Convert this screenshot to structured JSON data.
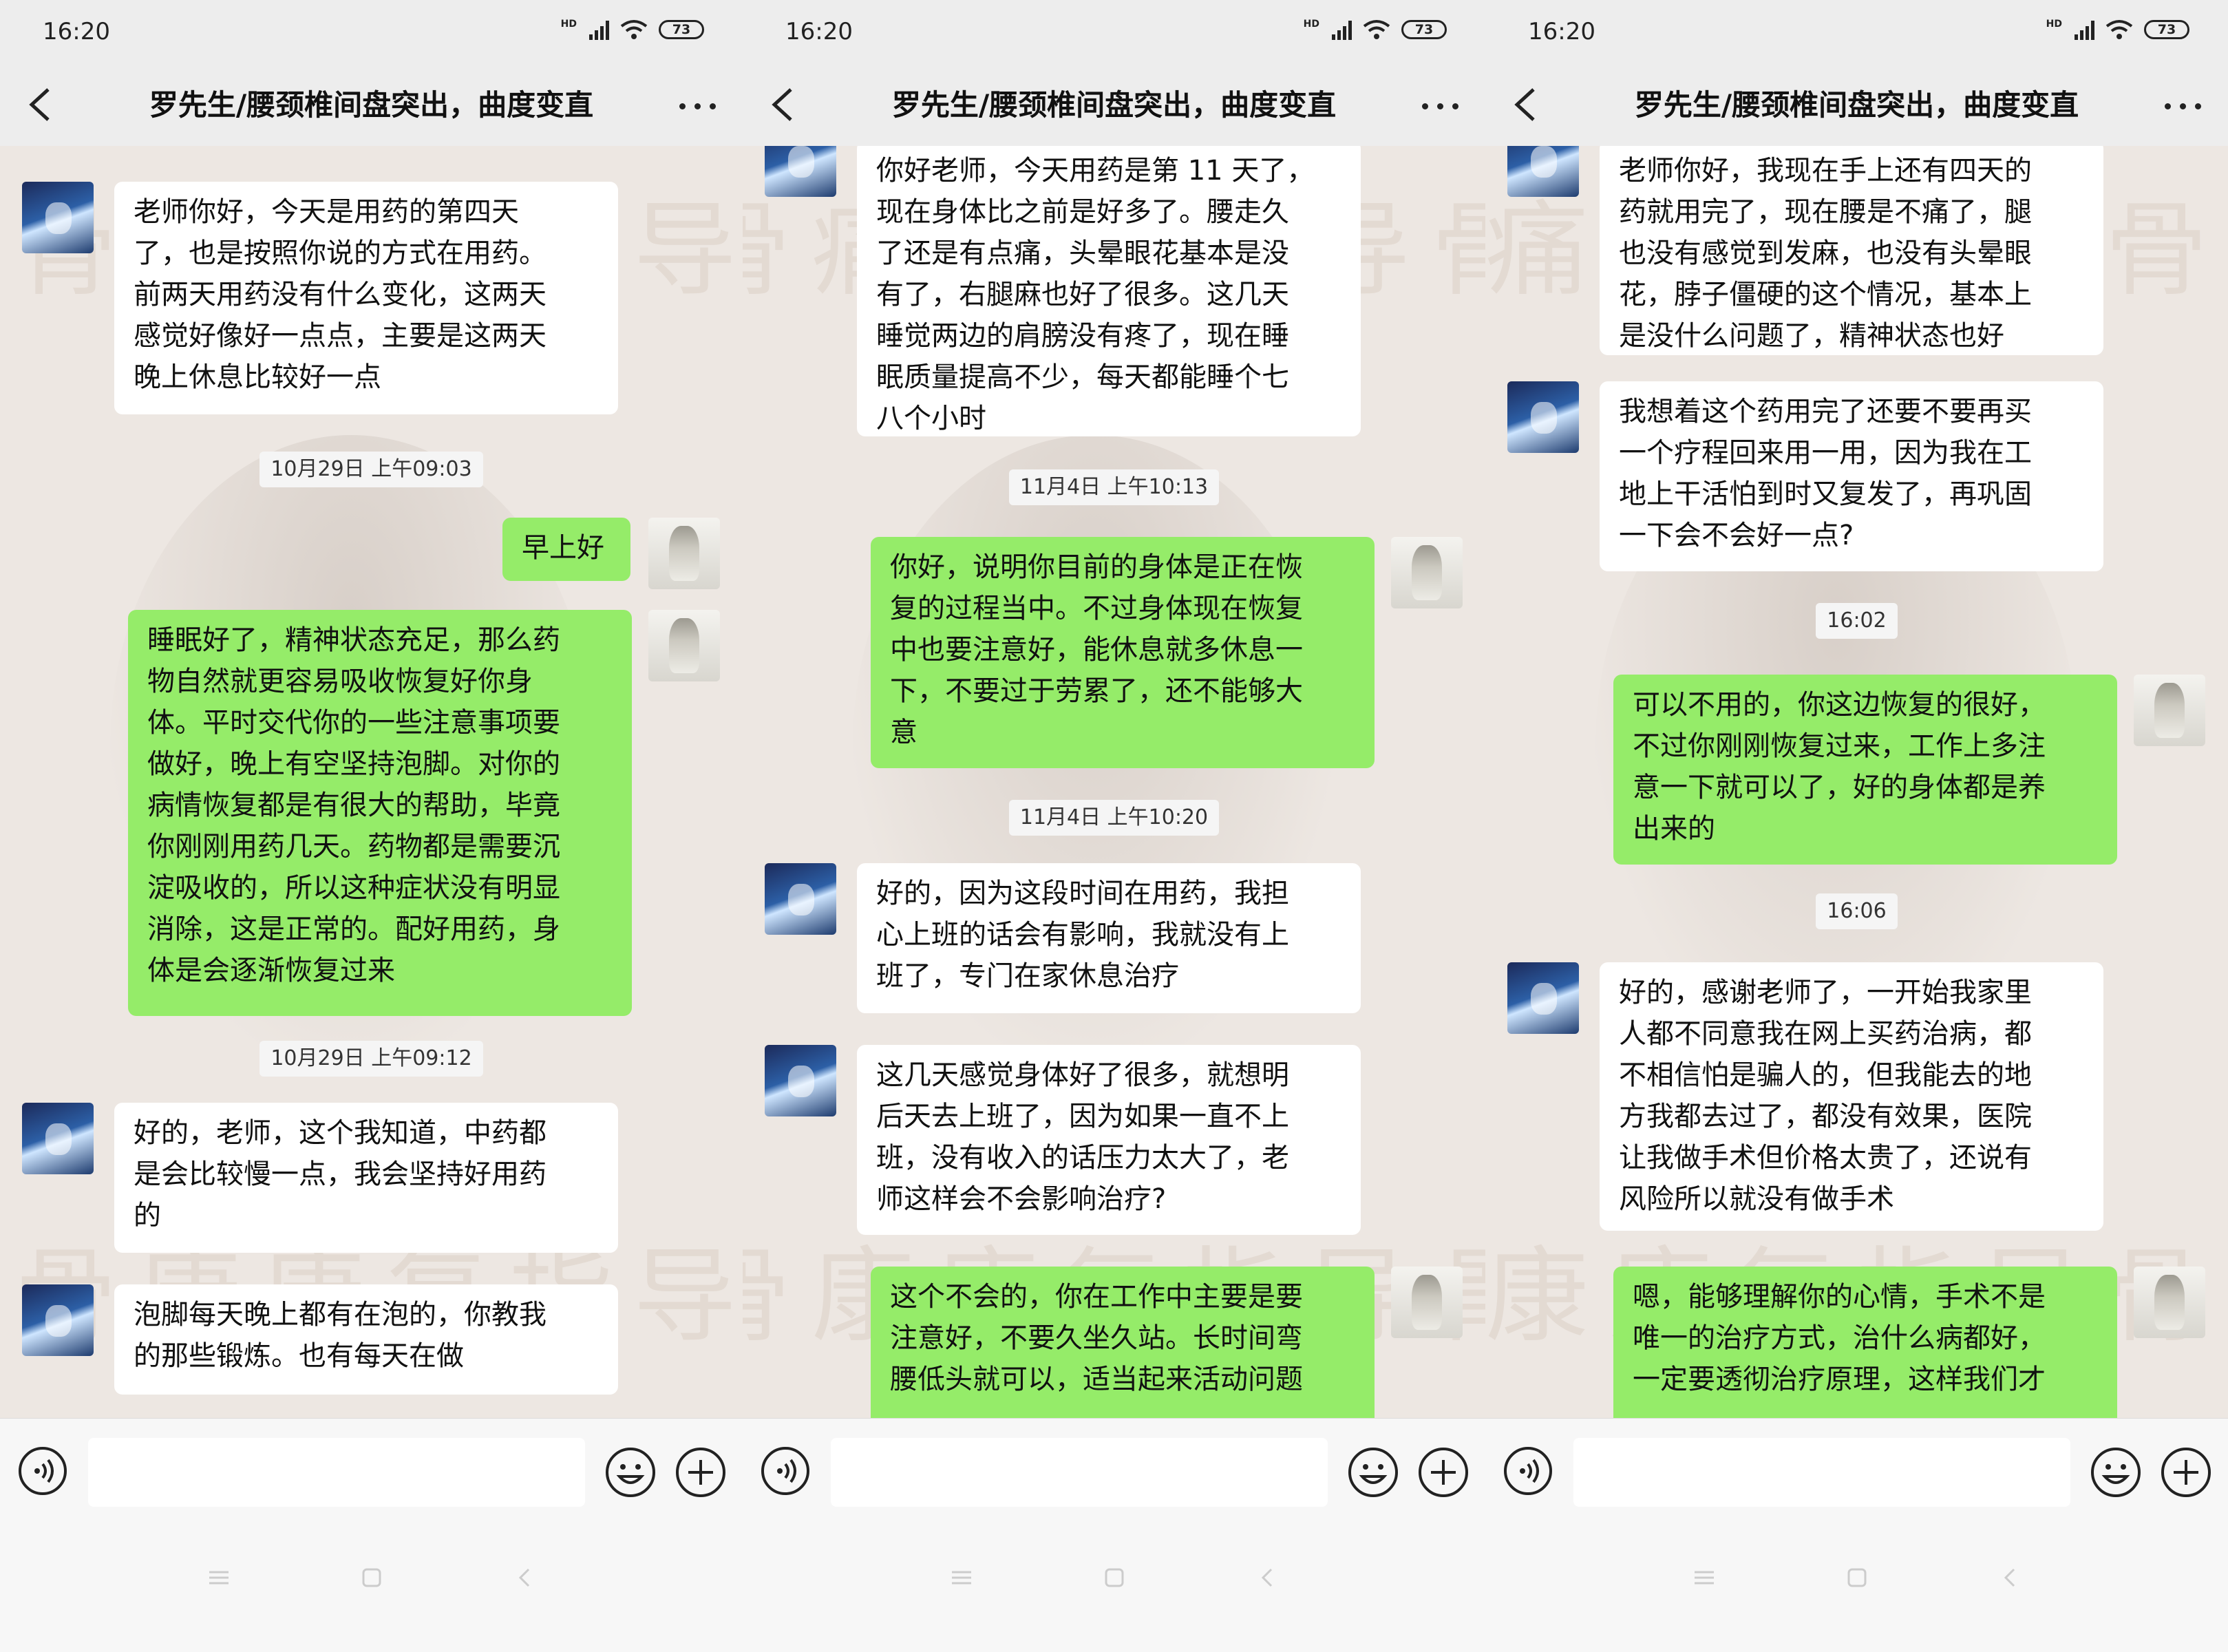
{
  "panels": [
    {
      "status": {
        "time": "16:20",
        "battery": "73"
      },
      "header": {
        "title": "罗先生/腰颈椎间盘突出，曲度变直"
      },
      "messages": [
        {
          "kind": "msg",
          "side": "left",
          "text": "老师你好，今天是用药的第四天\n了，也是按照你说的方式在用药。\n前两天用药没有什么变化，这两天\n感觉好像好一点点，主要是这两天\n晚上休息比较好一点"
        },
        {
          "kind": "time",
          "text": "10月29日 上午09:03"
        },
        {
          "kind": "msg",
          "side": "right",
          "text": "早上好"
        },
        {
          "kind": "msg",
          "side": "right",
          "text": "睡眠好了，精神状态充足，那么药\n物自然就更容易吸收恢复好你身\n体。平时交代你的一些注意事项要\n做好，晚上有空坚持泡脚。对你的\n病情恢复都是有很大的帮助，毕竟\n你刚刚用药几天。药物都是需要沉\n淀吸收的，所以这种症状没有明显\n消除，这是正常的。配好用药，身\n体是会逐渐恢复过来"
        },
        {
          "kind": "time",
          "text": "10月29日 上午09:12"
        },
        {
          "kind": "msg",
          "side": "left",
          "text": "好的，老师，这个我知道，中药都\n是会比较慢一点，我会坚持好用药\n的"
        },
        {
          "kind": "msg",
          "side": "left",
          "text": "泡脚每天晚上都有在泡的，你教我\n的那些锻炼。也有每天在做"
        }
      ]
    },
    {
      "status": {
        "time": "16:20",
        "battery": "73"
      },
      "header": {
        "title": "罗先生/腰颈椎间盘突出，曲度变直"
      },
      "messages": [
        {
          "kind": "msg",
          "side": "left",
          "text": "你好老师，今天用药是第 11 天了，\n现在身体比之前是好多了。腰走久\n了还是有点痛，头晕眼花基本是没\n有了，右腿麻也好了很多。这几天\n睡觉两边的肩膀没有疼了，现在睡\n眠质量提高不少，每天都能睡个七\n八个小时"
        },
        {
          "kind": "time",
          "text": "11月4日 上午10:13"
        },
        {
          "kind": "msg",
          "side": "right",
          "text": "你好，说明你目前的身体是正在恢\n复的过程当中。不过身体现在恢复\n中也要注意好，能休息就多休息一\n下，不要过于劳累了，还不能够大\n意"
        },
        {
          "kind": "time",
          "text": "11月4日 上午10:20"
        },
        {
          "kind": "msg",
          "side": "left",
          "text": "好的，因为这段时间在用药，我担\n心上班的话会有影响，我就没有上\n班了，专门在家休息治疗"
        },
        {
          "kind": "msg",
          "side": "left",
          "text": "这几天感觉身体好了很多，就想明\n后天去上班了，因为如果一直不上\n班，没有收入的话压力太大了，老\n师这样会不会影响治疗?"
        },
        {
          "kind": "msg",
          "side": "right",
          "text": "这个不会的，你在工作中主要是要\n注意好，不要久坐久站。长时间弯\n腰低头就可以，适当起来活动问题"
        }
      ]
    },
    {
      "status": {
        "time": "16:20",
        "battery": "73"
      },
      "header": {
        "title": "罗先生/腰颈椎间盘突出，曲度变直"
      },
      "messages": [
        {
          "kind": "msg",
          "side": "left",
          "text": "老师你好，我现在手上还有四天的\n药就用完了，现在腰是不痛了，腿\n也没有感觉到发麻，也没有头晕眼\n花，脖子僵硬的这个情况，基本上\n是没什么问题了，精神状态也好"
        },
        {
          "kind": "msg",
          "side": "left",
          "text": "我想着这个药用完了还要不要再买\n一个疗程回来用一用，因为我在工\n地上干活怕到时又复发了，再巩固\n一下会不会好一点?"
        },
        {
          "kind": "time",
          "text": "16:02"
        },
        {
          "kind": "msg",
          "side": "right",
          "text": "可以不用的，你这边恢复的很好，\n不过你刚刚恢复过来，工作上多注\n意一下就可以了，好的身体都是养\n出来的"
        },
        {
          "kind": "time",
          "text": "16:06"
        },
        {
          "kind": "msg",
          "side": "left",
          "text": "好的，感谢老师了，一开始我家里\n人都不同意我在网上买药治病，都\n不相信怕是骗人的，但我能去的地\n方我都去过了，都没有效果，医院\n让我做手术但价格太贵了，还说有\n风险所以就没有做手术"
        },
        {
          "kind": "msg",
          "side": "right",
          "text": "嗯，能够理解你的心情，手术不是\n唯一的治疗方式，治什么病都好，\n一定要透彻治疗原理，这样我们才"
        }
      ]
    }
  ],
  "watermark": {
    "line1": "骨痛康复指导骨",
    "line2": "骨康康复指导骨"
  },
  "icons": {
    "back": "chevron-left-icon",
    "more": "more-dots-icon",
    "voice": "voice-icon",
    "emoji": "emoji-icon",
    "plus": "plus-icon",
    "signal": "signal-icon",
    "wifi": "wifi-icon",
    "battery": "battery-icon"
  },
  "colors": {
    "sent_bubble": "#95ec69",
    "received_bubble": "#ffffff",
    "bar_bg": "#ededed"
  }
}
